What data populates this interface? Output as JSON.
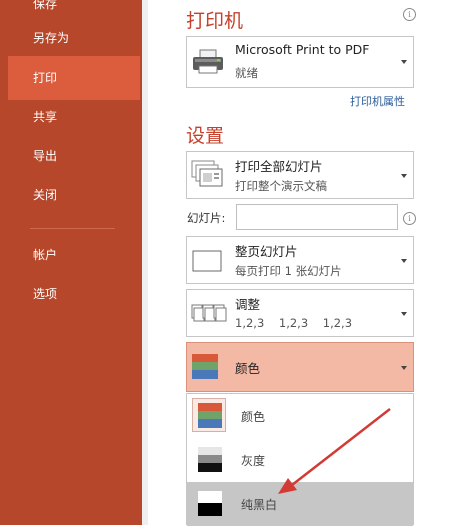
{
  "sidebar": {
    "items": [
      {
        "label": "保存"
      },
      {
        "label": "另存为"
      },
      {
        "label": "打印"
      },
      {
        "label": "共享"
      },
      {
        "label": "导出"
      },
      {
        "label": "关闭"
      },
      {
        "label": "帐户"
      },
      {
        "label": "选项"
      }
    ],
    "active_index": 2
  },
  "printer": {
    "title": "打印机",
    "name": "Microsoft Print to PDF",
    "status": "就绪",
    "properties_link": "打印机属性"
  },
  "settings": {
    "title": "设置",
    "range": {
      "label": "打印全部幻灯片",
      "sub": "打印整个演示文稿"
    },
    "slides_label": "幻灯片:",
    "slides_value": "",
    "layout": {
      "label": "整页幻灯片",
      "sub": "每页打印 1 张幻灯片"
    },
    "collate": {
      "label": "调整",
      "sub": "1,2,3    1,2,3    1,2,3"
    },
    "color": {
      "label": "颜色"
    }
  },
  "color_menu": {
    "options": [
      {
        "label": "颜色"
      },
      {
        "label": "灰度"
      },
      {
        "label": "纯黑白"
      }
    ],
    "highlighted_index": 2
  },
  "colors": {
    "sidebar_bg": "#b7472a",
    "sidebar_active": "#dc5c3e",
    "accent_title": "#c6412b",
    "color_dropdown_bg": "#f4b9a4",
    "menu_highlight": "#c6c6c6",
    "arrow": "#d23a33"
  }
}
